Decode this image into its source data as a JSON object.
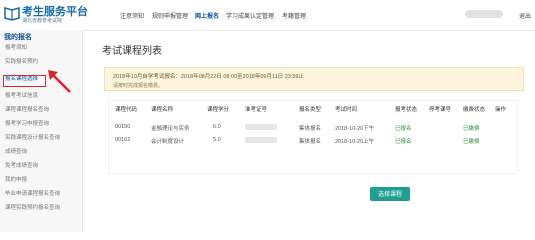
{
  "header": {
    "brand_title": "考生服务平台",
    "brand_subtitle": "湖北省教育考试院",
    "nav": [
      {
        "label": "注意须知"
      },
      {
        "label": "规则申报管理"
      },
      {
        "label": "网上报名"
      },
      {
        "label": "学习成果认定管理"
      },
      {
        "label": "考籍管理"
      }
    ],
    "active_nav_index": 2,
    "logout_label": "退出"
  },
  "sidebar": {
    "title": "我的报名",
    "items": [
      {
        "label": "报考须知"
      },
      {
        "label": "实践报名预约"
      },
      {
        "label": "报名课程选择"
      },
      {
        "label": "报考考试信息"
      },
      {
        "label": "课程课程报名查询"
      },
      {
        "label": "报考学习申报查询"
      },
      {
        "label": "实践课程设计报名查询"
      },
      {
        "label": "成绩查询"
      },
      {
        "label": "免考成绩查询"
      },
      {
        "label": "我的申报"
      },
      {
        "label": "毕业申请课程报名查询"
      },
      {
        "label": "课程实践预约报名查询"
      }
    ],
    "highlight_index": 2
  },
  "main": {
    "title": "考试课程列表",
    "notice_line1": "2018年10月自学考试报名：2018年08月22日 08:00至2018年09月11日 23:59止",
    "notice_line2": "请按时完成报名缴费。",
    "table_headers": [
      "课程代码",
      "课程名称",
      "课程学分",
      "准考证号",
      "报名类型",
      "考试时间",
      "报考状态",
      "停考课号",
      "缴费状态",
      "操作"
    ],
    "rows": [
      [
        "00150",
        "金融理论与实务",
        "6.0",
        "",
        "集体报名",
        "2018-10-20下午",
        "已报名",
        "",
        "已缴费",
        ""
      ],
      [
        "00162",
        "会计制度设计",
        "5.0",
        "",
        "集体报名",
        "2018-10-20上午",
        "已报名",
        "",
        "已缴费",
        ""
      ]
    ],
    "select_button_label": "选择课程"
  },
  "colors": {
    "brand": "#1769aa",
    "active_nav": "#0b4f9c",
    "notice_bg": "#fcf4dc",
    "button": "#1f9e91",
    "highlight_border": "#d9262a",
    "status_green": "#2c8a3f"
  }
}
